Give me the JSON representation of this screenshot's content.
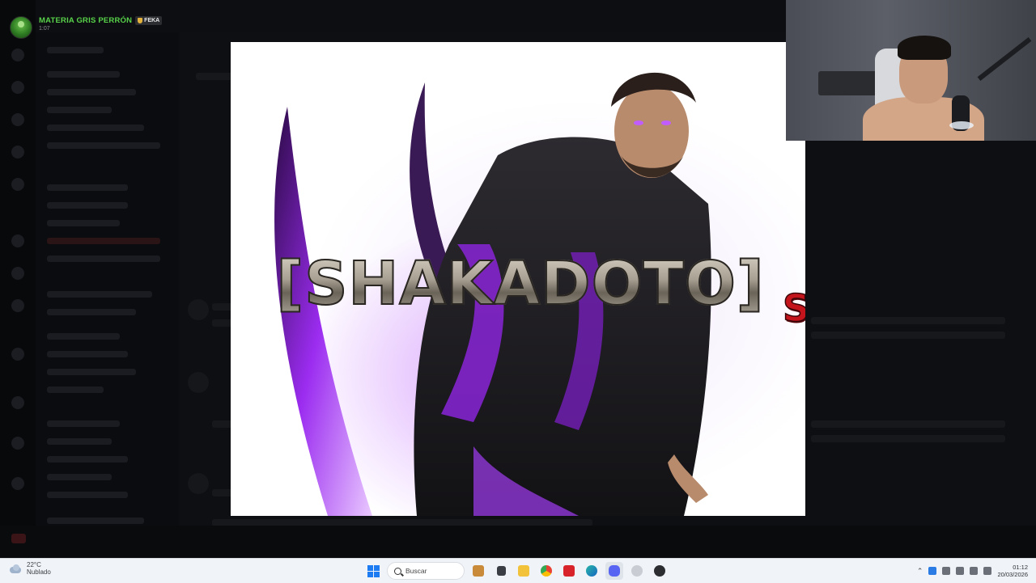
{
  "stream": {
    "username": "MATERIA GRIS PERRÓN",
    "tag": "FEKA",
    "duration": "1:07"
  },
  "artwork": {
    "logo_text": "[SHAKADOTO]",
    "logo_suffix": "S"
  },
  "taskbar": {
    "weather_temp": "22°C",
    "weather_condition": "Nublado",
    "search_label": "Buscar",
    "time": "01:12",
    "date": "20/03/2026"
  },
  "colors": {
    "username": "#58d34a",
    "logo_suffix": "#c4141c",
    "windows_blue": "#1d7cf2",
    "taskbar_bg": "#f0f3f8"
  }
}
